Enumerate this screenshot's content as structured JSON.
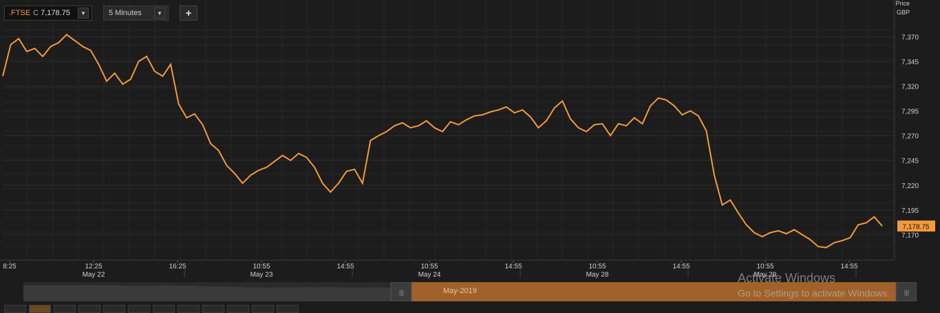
{
  "toolbar": {
    "symbol": ".FTSE",
    "close_flag": "C",
    "last_value": "7,178.75",
    "interval": "5 Minutes",
    "dropdown_glyph": "▼",
    "add_glyph": "+"
  },
  "axis": {
    "title_line1": "Price",
    "title_line2": "GBP"
  },
  "navigator": {
    "label": "May-2019"
  },
  "watermark": {
    "line1": "Activate Windows",
    "line2": "Go to Settings to activate Windows."
  },
  "colors": {
    "background": "#1c1c1c",
    "grid": "#2c2c2c",
    "line": "#f59a3c",
    "price_tag": "#f59a3c",
    "navigator_fill": "#a0622a"
  },
  "chart_data": {
    "type": "line",
    "series": [
      {
        "name": ".FTSE",
        "values": [
          7330,
          7362,
          7368,
          7355,
          7358,
          7350,
          7360,
          7364,
          7372,
          7366,
          7360,
          7356,
          7342,
          7325,
          7333,
          7322,
          7327,
          7345,
          7350,
          7335,
          7330,
          7342,
          7302,
          7288,
          7292,
          7281,
          7262,
          7255,
          7240,
          7232,
          7222,
          7230,
          7235,
          7238,
          7244,
          7250,
          7245,
          7252,
          7248,
          7238,
          7222,
          7213,
          7222,
          7234,
          7236,
          7222,
          7265,
          7270,
          7274,
          7280,
          7283,
          7278,
          7280,
          7285,
          7278,
          7274,
          7284,
          7281,
          7286,
          7290,
          7291,
          7294,
          7296,
          7299,
          7293,
          7296,
          7289,
          7278,
          7285,
          7298,
          7305,
          7287,
          7278,
          7274,
          7281,
          7282,
          7270,
          7282,
          7280,
          7288,
          7282,
          7300,
          7308,
          7306,
          7300,
          7291,
          7295,
          7290,
          7275,
          7230,
          7200,
          7205,
          7192,
          7180,
          7172,
          7168,
          7172,
          7174,
          7171,
          7175,
          7170,
          7165,
          7158,
          7157,
          7162,
          7164,
          7167,
          7180,
          7182,
          7188,
          7178.75
        ],
        "last": 7178.75
      }
    ],
    "x_ticks": [
      {
        "label": "8:25",
        "date": ""
      },
      {
        "label": "12:25",
        "date": "May 22"
      },
      {
        "label": "16:25",
        "date": ""
      },
      {
        "label": "10:55",
        "date": "May 23"
      },
      {
        "label": "14:55",
        "date": ""
      },
      {
        "label": "10:55",
        "date": "May 24"
      },
      {
        "label": "14:55",
        "date": ""
      },
      {
        "label": "10:55",
        "date": "May 28"
      },
      {
        "label": "14:55",
        "date": ""
      },
      {
        "label": "10:55",
        "date": "May 29"
      },
      {
        "label": "14:55",
        "date": ""
      }
    ],
    "y_ticks": [
      7370,
      7345,
      7320,
      7295,
      7270,
      7245,
      7220,
      7195,
      7170
    ],
    "y_tick_labels": [
      "7,370",
      "7,345",
      "7,320",
      "7,295",
      "7,270",
      "7,245",
      "7,220",
      "7,195",
      "7,170"
    ],
    "ylim": [
      7145,
      7382
    ],
    "last_label": "7,178.75",
    "grid": true
  }
}
